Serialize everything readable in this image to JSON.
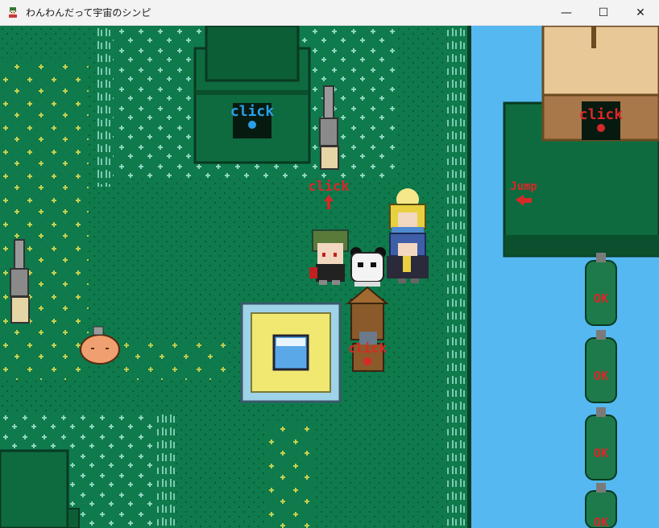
{
  "window": {
    "title": "わんわんだって宇宙のシンピ",
    "minimize_glyph": "—",
    "maximize_glyph": "☐",
    "close_glyph": "✕"
  },
  "map": {
    "prompts": {
      "click_top_building": "click",
      "click_right_house": "click",
      "click_path": "click",
      "click_well": "click",
      "jump": "Jump"
    },
    "gas_tanks": [
      "OK",
      "OK",
      "OK",
      "OK"
    ]
  },
  "colors": {
    "grass": "#0f7a4c",
    "grass_dark": "#0b6a40",
    "water": "#56b8f0",
    "building_green": "#0e6b3f",
    "house_wall": "#e9c898",
    "prompt_red": "#d82828",
    "prompt_blue": "#2a9fe8"
  },
  "icons": {
    "app": "character-icon",
    "minimize": "minimize-icon",
    "maximize": "maximize-icon",
    "close": "close-icon"
  }
}
